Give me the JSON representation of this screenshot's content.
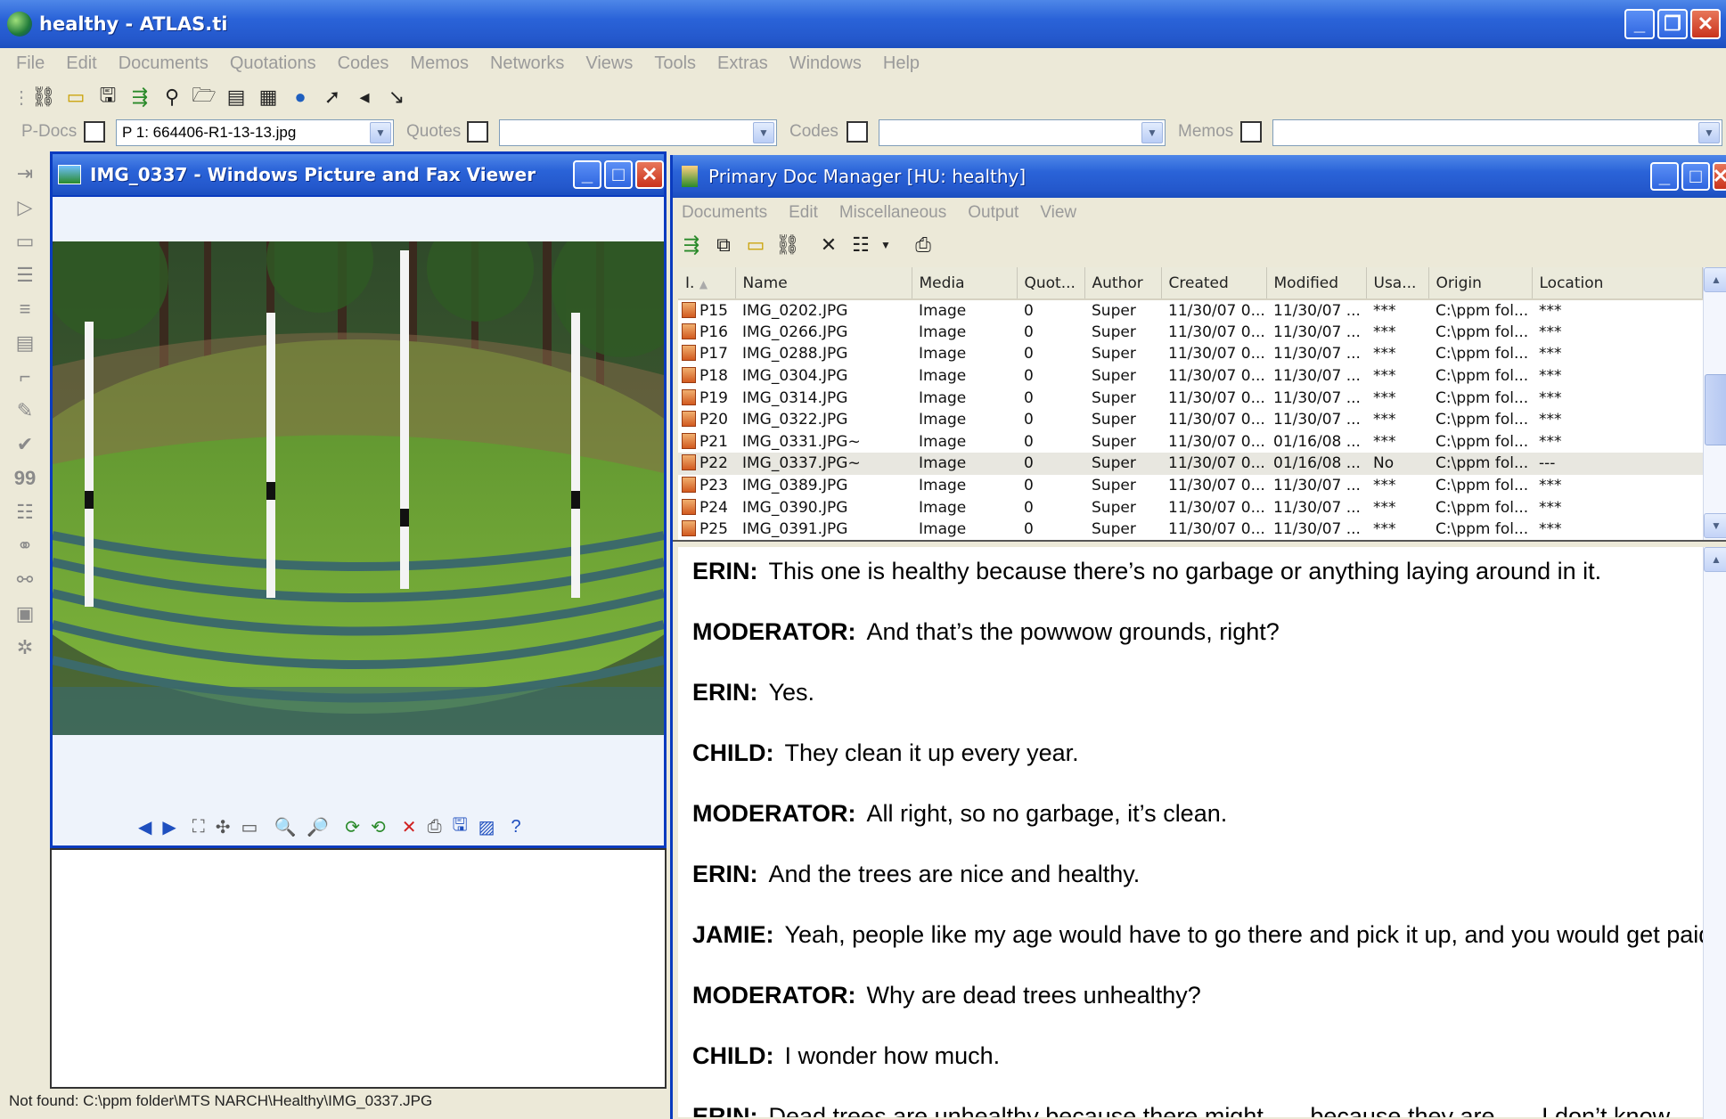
{
  "app": {
    "title": "healthy - ATLAS.ti",
    "menu": [
      "File",
      "Edit",
      "Documents",
      "Quotations",
      "Codes",
      "Memos",
      "Networks",
      "Views",
      "Tools",
      "Extras",
      "Windows",
      "Help"
    ],
    "selectors": {
      "pdocs_label": "P-Docs",
      "pdocs_value": "P 1: 664406-R1-13-13.jpg",
      "quotes_label": "Quotes",
      "quotes_value": "",
      "codes_label": "Codes",
      "codes_value": "",
      "memos_label": "Memos",
      "memos_value": ""
    },
    "status_text": "Not found: C:\\ppm folder\\MTS NARCH\\Healthy\\IMG_0337.JPG"
  },
  "viewer": {
    "title": "IMG_0337 - Windows Picture and Fax Viewer"
  },
  "pdm": {
    "title": "Primary Doc Manager [HU: healthy]",
    "menu": [
      "Documents",
      "Edit",
      "Miscellaneous",
      "Output",
      "View"
    ],
    "columns": [
      "I.",
      "Name",
      "Media",
      "Quot...",
      "Author",
      "Created",
      "Modified",
      "Usa...",
      "Origin",
      "Location"
    ],
    "rows": [
      {
        "id": "P15",
        "name": "IMG_0202.JPG",
        "media": "Image",
        "quot": "0",
        "author": "Super",
        "created": "11/30/07 0...",
        "modified": "11/30/07 ...",
        "usage": "***",
        "origin": "C:\\ppm fol...",
        "location": "***"
      },
      {
        "id": "P16",
        "name": "IMG_0266.JPG",
        "media": "Image",
        "quot": "0",
        "author": "Super",
        "created": "11/30/07 0...",
        "modified": "11/30/07 ...",
        "usage": "***",
        "origin": "C:\\ppm fol...",
        "location": "***"
      },
      {
        "id": "P17",
        "name": "IMG_0288.JPG",
        "media": "Image",
        "quot": "0",
        "author": "Super",
        "created": "11/30/07 0...",
        "modified": "11/30/07 ...",
        "usage": "***",
        "origin": "C:\\ppm fol...",
        "location": "***"
      },
      {
        "id": "P18",
        "name": "IMG_0304.JPG",
        "media": "Image",
        "quot": "0",
        "author": "Super",
        "created": "11/30/07 0...",
        "modified": "11/30/07 ...",
        "usage": "***",
        "origin": "C:\\ppm fol...",
        "location": "***"
      },
      {
        "id": "P19",
        "name": "IMG_0314.JPG",
        "media": "Image",
        "quot": "0",
        "author": "Super",
        "created": "11/30/07 0...",
        "modified": "11/30/07 ...",
        "usage": "***",
        "origin": "C:\\ppm fol...",
        "location": "***"
      },
      {
        "id": "P20",
        "name": "IMG_0322.JPG",
        "media": "Image",
        "quot": "0",
        "author": "Super",
        "created": "11/30/07 0...",
        "modified": "11/30/07 ...",
        "usage": "***",
        "origin": "C:\\ppm fol...",
        "location": "***"
      },
      {
        "id": "P21",
        "name": "IMG_0331.JPG~",
        "media": "Image",
        "quot": "0",
        "author": "Super",
        "created": "11/30/07 0...",
        "modified": "01/16/08 ...",
        "usage": "***",
        "origin": "C:\\ppm fol...",
        "location": "***"
      },
      {
        "id": "P22",
        "name": "IMG_0337.JPG~",
        "media": "Image",
        "quot": "0",
        "author": "Super",
        "created": "11/30/07 0...",
        "modified": "01/16/08 ...",
        "usage": "No",
        "origin": "C:\\ppm fol...",
        "location": "---"
      },
      {
        "id": "P23",
        "name": "IMG_0389.JPG",
        "media": "Image",
        "quot": "0",
        "author": "Super",
        "created": "11/30/07 0...",
        "modified": "11/30/07 ...",
        "usage": "***",
        "origin": "C:\\ppm fol...",
        "location": "***"
      },
      {
        "id": "P24",
        "name": "IMG_0390.JPG",
        "media": "Image",
        "quot": "0",
        "author": "Super",
        "created": "11/30/07 0...",
        "modified": "11/30/07 ...",
        "usage": "***",
        "origin": "C:\\ppm fol...",
        "location": "***"
      },
      {
        "id": "P25",
        "name": "IMG_0391.JPG",
        "media": "Image",
        "quot": "0",
        "author": "Super",
        "created": "11/30/07 0...",
        "modified": "11/30/07 ...",
        "usage": "***",
        "origin": "C:\\ppm fol...",
        "location": "***"
      }
    ],
    "selected_row": "P22"
  },
  "transcript": [
    {
      "speaker": "ERIN:",
      "text": "This one is healthy because there’s no garbage or anything laying around in it."
    },
    {
      "speaker": "MODERATOR:",
      "text": "And that’s the powwow grounds, right?"
    },
    {
      "speaker": "ERIN:",
      "text": "Yes."
    },
    {
      "speaker": "CHILD:",
      "text": "They clean it up every year."
    },
    {
      "speaker": "MODERATOR:",
      "text": "All right, so no garbage, it’s clean."
    },
    {
      "speaker": "ERIN:",
      "text": "And the trees are nice and healthy."
    },
    {
      "speaker": "JAMIE:",
      "text": "Yeah, people like my age would have to go there and pick it up, and you would get paid."
    },
    {
      "speaker": "MODERATOR:",
      "text": "Why are dead trees unhealthy?"
    },
    {
      "speaker": "CHILD:",
      "text": "I wonder how much."
    },
    {
      "speaker": "ERIN:",
      "text": "Dead trees are unhealthy because there might . . . because they are . . . I don’t know."
    }
  ],
  "colors": {
    "title_blue": "#2458cc",
    "close_red": "#c9331c",
    "selected_row": "#e8e7e0"
  }
}
